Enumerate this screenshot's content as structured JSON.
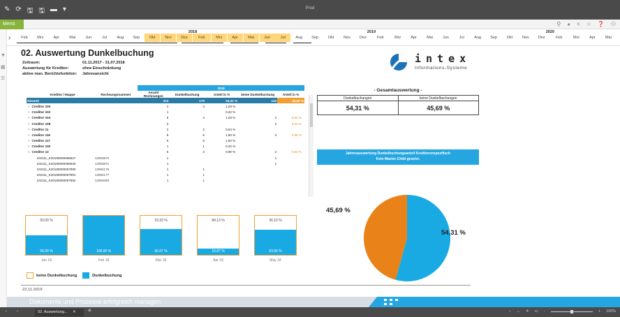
{
  "app": {
    "title": "Prod",
    "menu_label": "Menü"
  },
  "quick_access": [
    "✎",
    "⟳",
    "🖫",
    "🖫",
    "▬",
    "▾"
  ],
  "menubar_icons": [
    "⚲",
    "◕",
    "<",
    "☆",
    "❓",
    "⚇"
  ],
  "timeline": {
    "months": [
      "Feb",
      "Mrz",
      "Apr",
      "Mai",
      "Jun",
      "Jul",
      "Aug",
      "Sep",
      "Okt",
      "Nov",
      "Dez",
      "Feb",
      "Mrz",
      "Apr",
      "Mai",
      "Jun",
      "Jul",
      "Aug",
      "Sep",
      "Okt",
      "Nov",
      "Dez",
      "Feb",
      "Mrz",
      "Apr",
      "Mai",
      "Jun",
      "Jul",
      "Aug",
      "Sep",
      "Okt",
      "Nov",
      "Dez",
      "Feb",
      "Mrz",
      "Apr",
      "Mai"
    ],
    "years": [
      "2018",
      "2019",
      "2020"
    ]
  },
  "report": {
    "title": "02. Auswertung Dunkelbuchung",
    "meta": [
      {
        "label": "Zeitraum:",
        "value": "01.11.2017 - 31.07.2018"
      },
      {
        "label": "Auswertung für Kreditor:",
        "value": "ohne Einschränkung"
      },
      {
        "label": "aktive man. Berichtsfunktion:",
        "value": "Jahresansicht"
      }
    ],
    "logo": {
      "name": "intex",
      "subtitle": "Informations-Systeme"
    },
    "table": {
      "year": "2018",
      "headers": [
        "Kreditor / Mappe",
        "Rechnungsnummer",
        "Anzahl Rechnungen",
        "Dunkelbuchung",
        "Anteil in %",
        "keine Dunkelbuchung",
        "Anteil in %"
      ],
      "total": [
        "Gesamt",
        "",
        "313",
        "170",
        "54,31 %",
        "143",
        "45,69 %"
      ],
      "rows": [
        [
          ">",
          "Creditor 100",
          "",
          "4",
          "4",
          "1,28 %",
          "",
          ""
        ],
        [
          ">",
          "Creditor 102",
          "",
          "1",
          "",
          "0,32 %",
          "",
          ""
        ],
        [
          ">",
          "Creditor 104",
          "",
          "6",
          "4",
          "1,28 %",
          "2",
          "0,64 %"
        ],
        [
          ">",
          "Creditor 108",
          "",
          "2",
          "",
          "",
          "2",
          "0,64 %"
        ],
        [
          ">",
          "Creditor 11",
          "",
          "2",
          "2",
          "0,64 %",
          "",
          ""
        ],
        [
          ">",
          "Creditor 116",
          "",
          "8",
          "5",
          "1,60 %",
          "3",
          "0,96 %"
        ],
        [
          ">",
          "Creditor 117",
          "",
          "6",
          "6",
          "1,92 %",
          "",
          ""
        ],
        [
          ">",
          "Creditor 118",
          "",
          "1",
          "1",
          "0,32 %",
          "",
          ""
        ],
        [
          "v",
          "Creditor 12",
          "",
          "5",
          "3",
          "0,96 %",
          "2",
          "0,64 %"
        ],
        [
          "",
          "102111_K20180000066527",
          "12093870",
          "1",
          "",
          "",
          "1",
          ""
        ],
        [
          "",
          "102111_K20180000066530",
          "12093871",
          "1",
          "",
          "",
          "1",
          ""
        ],
        [
          "",
          "102111_K20180000067890",
          "12094176",
          "1",
          "1",
          "",
          "",
          ""
        ],
        [
          "",
          "102111_K20180000067891",
          "12094177",
          "1",
          "1",
          "",
          "",
          ""
        ],
        [
          "",
          "102111_K20180000067892",
          "12094093",
          "1",
          "1",
          "",
          "",
          ""
        ]
      ]
    },
    "bars": [
      {
        "top_label": "50.00 %",
        "bottom_label": "50.00 %",
        "blue_fraction": 0.5,
        "category": "Jan 18"
      },
      {
        "top_label": "",
        "bottom_label": "100.00 %",
        "blue_fraction": 1.0,
        "category": "Feb 18"
      },
      {
        "top_label": "33.33 %",
        "bottom_label": "66.67 %",
        "blue_fraction": 0.6667,
        "category": "Mar 18"
      },
      {
        "top_label": "84.13 %",
        "bottom_label": "15.87 %",
        "blue_fraction": 0.1587,
        "category": "Apr 18"
      },
      {
        "top_label": "36.10 %",
        "bottom_label": "63.90 %",
        "blue_fraction": 0.639,
        "category": "May 18"
      }
    ],
    "legend": {
      "none": "keine Dunkelbuchung",
      "dark": "Dunkelbuchung"
    },
    "summary": {
      "title": "- Gesamtauswertung -",
      "col1": "Dunkelbuchungen",
      "col2": "keine Dunkelbuchungen",
      "val1": "54,31 %",
      "val2": "45,69 %"
    },
    "banner": {
      "line1": "Jahresauswertung Dunkelbuchungsanteil Kreditorenspezifisch",
      "line2": "Kein Master-Child gesetzt."
    },
    "pie": {
      "label_blue": "54,31 %",
      "label_orange": "45,69 %"
    },
    "date": "22.11.2019",
    "footer": "Dokumente und Prozesse erfolgreich managen"
  },
  "colors": {
    "blue": "#19aae4",
    "orange": "#f0a033",
    "pie_orange": "#e98218",
    "green": "#88b43c"
  },
  "chart_data": [
    {
      "type": "bar",
      "categories": [
        "Jan 18",
        "Feb 18",
        "Mar 18",
        "Apr 18",
        "May 18"
      ],
      "series": [
        {
          "name": "Dunkelbuchung",
          "values": [
            50.0,
            100.0,
            66.67,
            15.87,
            63.9
          ]
        },
        {
          "name": "keine Dunkelbuchung",
          "values": [
            50.0,
            0,
            33.33,
            84.13,
            36.1
          ]
        }
      ],
      "stacked": true,
      "ylim": [
        0,
        100
      ]
    },
    {
      "type": "pie",
      "categories": [
        "Dunkelbuchungen",
        "keine Dunkelbuchungen"
      ],
      "values": [
        54.31,
        45.69
      ]
    }
  ],
  "statusbar": {
    "tab": "02. Auswertung...",
    "right": [
      "↕",
      "↔",
      "✛",
      "▭",
      "-",
      "+",
      "100%"
    ]
  }
}
